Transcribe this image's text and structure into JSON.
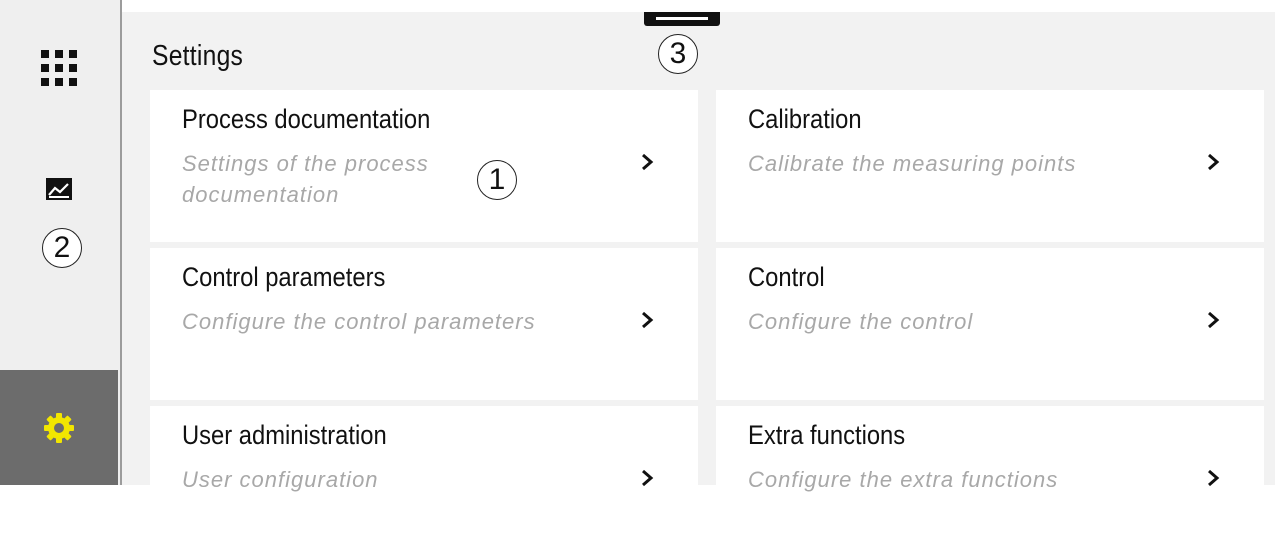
{
  "app": {
    "page_title": "Settings"
  },
  "sidebar": {
    "items": [
      {
        "name": "apps",
        "icon": "apps-grid-icon"
      },
      {
        "name": "chart",
        "icon": "line-chart-icon"
      },
      {
        "name": "settings",
        "icon": "gear-icon",
        "active": true
      }
    ]
  },
  "callouts": {
    "c1": "1",
    "c2": "2",
    "c3": "3"
  },
  "cards": [
    {
      "title": "Process documentation",
      "description": "Settings of the process documentation"
    },
    {
      "title": "Calibration",
      "description": "Calibrate the measuring points"
    },
    {
      "title": "Control parameters",
      "description": "Configure the control parameters"
    },
    {
      "title": "Control",
      "description": "Configure the control"
    },
    {
      "title": "User administration",
      "description": "User configuration"
    },
    {
      "title": "Extra functions",
      "description": "Configure the extra functions"
    }
  ],
  "colors": {
    "active_icon": "#f2e600",
    "active_bg": "#6c6c6c",
    "description": "#a8a8a8"
  }
}
